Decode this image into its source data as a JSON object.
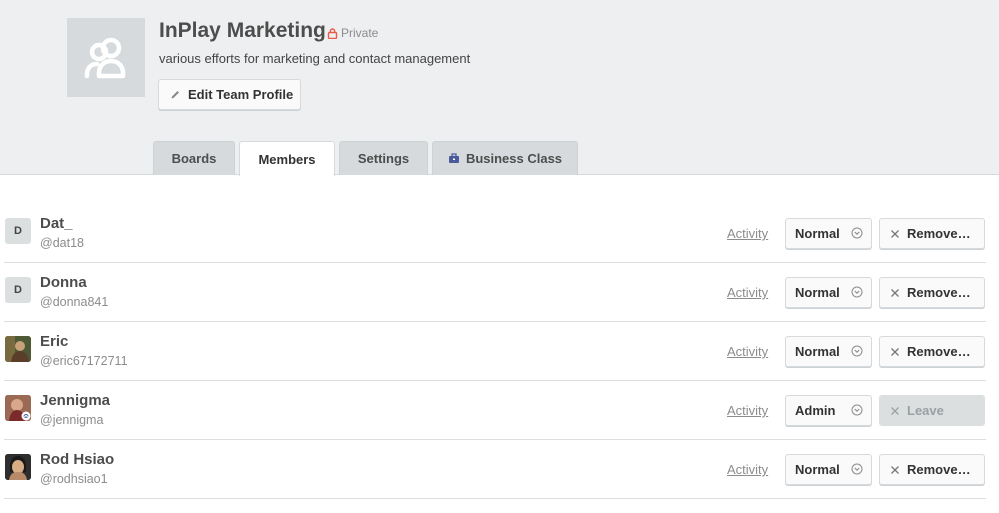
{
  "team": {
    "name": "InPlay Marketing",
    "visibility": "Private",
    "description": "various efforts for marketing and contact management",
    "edit_label": "Edit Team Profile"
  },
  "tabs": [
    {
      "label": "Boards",
      "active": false
    },
    {
      "label": "Members",
      "active": true
    },
    {
      "label": "Settings",
      "active": false
    },
    {
      "label": "Business Class",
      "active": false,
      "icon": "briefcase-icon"
    }
  ],
  "members": [
    {
      "initial": "D",
      "name": "Dat_",
      "username": "@dat18",
      "activity": "Activity",
      "permission": "Normal",
      "action": "Remove…",
      "action_disabled": false
    },
    {
      "initial": "D",
      "name": "Donna",
      "username": "@donna841",
      "activity": "Activity",
      "permission": "Normal",
      "action": "Remove…",
      "action_disabled": false
    },
    {
      "initial": "",
      "name": "Eric",
      "username": "@eric67172711",
      "activity": "Activity",
      "permission": "Normal",
      "action": "Remove…",
      "action_disabled": false
    },
    {
      "initial": "",
      "name": "Jennigma",
      "username": "@jennigma",
      "activity": "Activity",
      "permission": "Admin",
      "action": "Leave",
      "action_disabled": true
    },
    {
      "initial": "",
      "name": "Rod Hsiao",
      "username": "@rodhsiao1",
      "activity": "Activity",
      "permission": "Normal",
      "action": "Remove…",
      "action_disabled": false
    }
  ],
  "colors": {
    "header_bg": "#edeff0",
    "private_lock": "#eb5a46",
    "business_icon": "#4a5a9a"
  }
}
